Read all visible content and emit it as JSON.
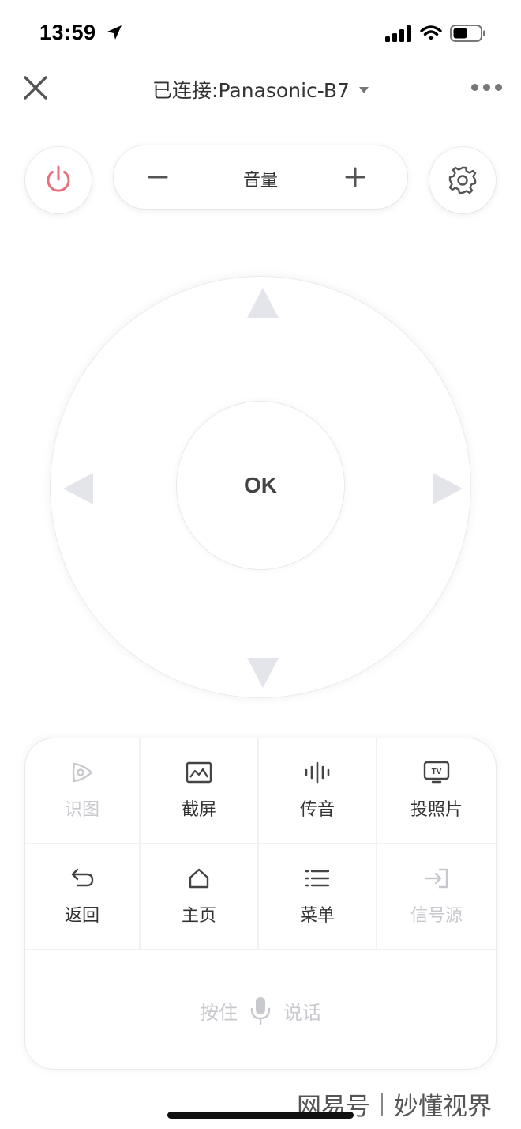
{
  "status_bar": {
    "time": "13:59"
  },
  "header": {
    "title": "已连接:Panasonic-B7"
  },
  "volume": {
    "label": "音量",
    "minus": "−",
    "plus": "+"
  },
  "dpad": {
    "ok_label": "OK"
  },
  "functions": [
    {
      "label": "识图",
      "icon": "image-recognition-icon",
      "enabled": false
    },
    {
      "label": "截屏",
      "icon": "screenshot-icon",
      "enabled": true
    },
    {
      "label": "传音",
      "icon": "voice-wave-icon",
      "enabled": true
    },
    {
      "label": "投照片",
      "icon": "cast-photo-tv-icon",
      "enabled": true
    },
    {
      "label": "返回",
      "icon": "back-arrow-icon",
      "enabled": true
    },
    {
      "label": "主页",
      "icon": "home-icon",
      "enabled": true
    },
    {
      "label": "菜单",
      "icon": "menu-list-icon",
      "enabled": true
    },
    {
      "label": "信号源",
      "icon": "input-source-icon",
      "enabled": false
    }
  ],
  "talk": {
    "left": "按住",
    "right": "说话"
  },
  "watermark": {
    "left": "网易号",
    "right": "妙懂视界"
  },
  "colors": {
    "power": "#e8707e",
    "disabled": "#c8c9ce",
    "arrow": "#e4e5ea"
  }
}
